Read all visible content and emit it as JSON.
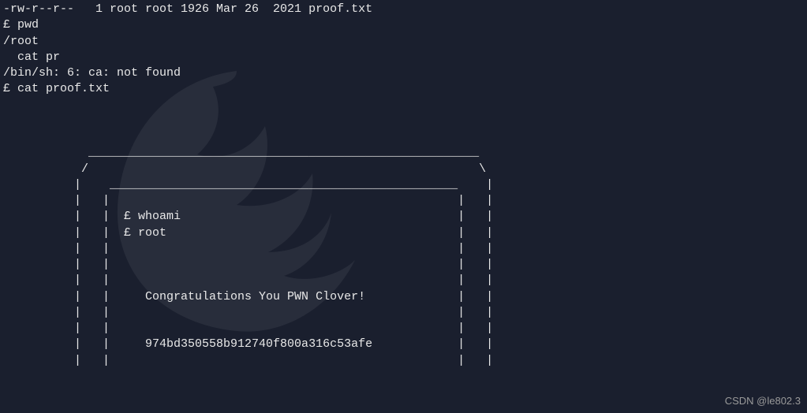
{
  "lines": {
    "l0": "-rw-r--r--   1 root root 1926 Mar 26  2021 proof.txt",
    "l1": "£ pwd",
    "l2": "/root",
    "l3": "  cat pr",
    "l4": "/bin/sh: 6: ca: not found",
    "l5": "£ cat proof.txt",
    "l6": "                                                                                ",
    "l7": "                                                                                ",
    "l8": "                                                                                ",
    "l9": "            _______________________________________________________             ",
    "l10": "           /                                                       \\            ",
    "l11": "          |    _________________________________________________    |           ",
    "l12": "          |   |                                                 |   |           ",
    "l13": "          |   |  £ whoami                                       |   |           ",
    "l14": "          |   |  £ root                                         |   |           ",
    "l15": "          |   |                                                 |   |           ",
    "l16": "          |   |                                                 |   |           ",
    "l17": "          |   |                                                 |   |           ",
    "l18": "          |   |     Congratulations You PWN Clover!             |   |           ",
    "l19": "          |   |                                                 |   |           ",
    "l20": "          |   |                                                 |   |           ",
    "l21": "          |   |     974bd350558b912740f800a316c53afe            |   |           ",
    "l22": "          |   |                                                 |   |           "
  },
  "watermark": "CSDN @le802.3"
}
